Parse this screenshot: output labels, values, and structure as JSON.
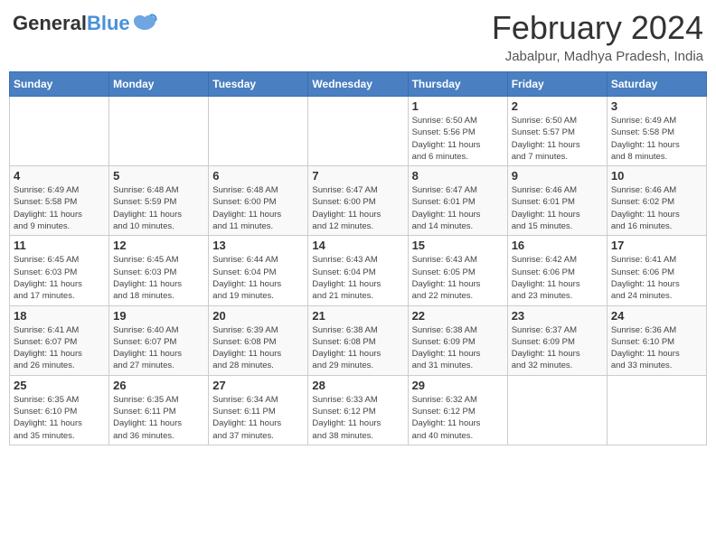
{
  "header": {
    "logo_general": "General",
    "logo_blue": "Blue",
    "month_year": "February 2024",
    "location": "Jabalpur, Madhya Pradesh, India"
  },
  "days_of_week": [
    "Sunday",
    "Monday",
    "Tuesday",
    "Wednesday",
    "Thursday",
    "Friday",
    "Saturday"
  ],
  "weeks": [
    [
      {
        "day": "",
        "info": ""
      },
      {
        "day": "",
        "info": ""
      },
      {
        "day": "",
        "info": ""
      },
      {
        "day": "",
        "info": ""
      },
      {
        "day": "1",
        "info": "Sunrise: 6:50 AM\nSunset: 5:56 PM\nDaylight: 11 hours\nand 6 minutes."
      },
      {
        "day": "2",
        "info": "Sunrise: 6:50 AM\nSunset: 5:57 PM\nDaylight: 11 hours\nand 7 minutes."
      },
      {
        "day": "3",
        "info": "Sunrise: 6:49 AM\nSunset: 5:58 PM\nDaylight: 11 hours\nand 8 minutes."
      }
    ],
    [
      {
        "day": "4",
        "info": "Sunrise: 6:49 AM\nSunset: 5:58 PM\nDaylight: 11 hours\nand 9 minutes."
      },
      {
        "day": "5",
        "info": "Sunrise: 6:48 AM\nSunset: 5:59 PM\nDaylight: 11 hours\nand 10 minutes."
      },
      {
        "day": "6",
        "info": "Sunrise: 6:48 AM\nSunset: 6:00 PM\nDaylight: 11 hours\nand 11 minutes."
      },
      {
        "day": "7",
        "info": "Sunrise: 6:47 AM\nSunset: 6:00 PM\nDaylight: 11 hours\nand 12 minutes."
      },
      {
        "day": "8",
        "info": "Sunrise: 6:47 AM\nSunset: 6:01 PM\nDaylight: 11 hours\nand 14 minutes."
      },
      {
        "day": "9",
        "info": "Sunrise: 6:46 AM\nSunset: 6:01 PM\nDaylight: 11 hours\nand 15 minutes."
      },
      {
        "day": "10",
        "info": "Sunrise: 6:46 AM\nSunset: 6:02 PM\nDaylight: 11 hours\nand 16 minutes."
      }
    ],
    [
      {
        "day": "11",
        "info": "Sunrise: 6:45 AM\nSunset: 6:03 PM\nDaylight: 11 hours\nand 17 minutes."
      },
      {
        "day": "12",
        "info": "Sunrise: 6:45 AM\nSunset: 6:03 PM\nDaylight: 11 hours\nand 18 minutes."
      },
      {
        "day": "13",
        "info": "Sunrise: 6:44 AM\nSunset: 6:04 PM\nDaylight: 11 hours\nand 19 minutes."
      },
      {
        "day": "14",
        "info": "Sunrise: 6:43 AM\nSunset: 6:04 PM\nDaylight: 11 hours\nand 21 minutes."
      },
      {
        "day": "15",
        "info": "Sunrise: 6:43 AM\nSunset: 6:05 PM\nDaylight: 11 hours\nand 22 minutes."
      },
      {
        "day": "16",
        "info": "Sunrise: 6:42 AM\nSunset: 6:06 PM\nDaylight: 11 hours\nand 23 minutes."
      },
      {
        "day": "17",
        "info": "Sunrise: 6:41 AM\nSunset: 6:06 PM\nDaylight: 11 hours\nand 24 minutes."
      }
    ],
    [
      {
        "day": "18",
        "info": "Sunrise: 6:41 AM\nSunset: 6:07 PM\nDaylight: 11 hours\nand 26 minutes."
      },
      {
        "day": "19",
        "info": "Sunrise: 6:40 AM\nSunset: 6:07 PM\nDaylight: 11 hours\nand 27 minutes."
      },
      {
        "day": "20",
        "info": "Sunrise: 6:39 AM\nSunset: 6:08 PM\nDaylight: 11 hours\nand 28 minutes."
      },
      {
        "day": "21",
        "info": "Sunrise: 6:38 AM\nSunset: 6:08 PM\nDaylight: 11 hours\nand 29 minutes."
      },
      {
        "day": "22",
        "info": "Sunrise: 6:38 AM\nSunset: 6:09 PM\nDaylight: 11 hours\nand 31 minutes."
      },
      {
        "day": "23",
        "info": "Sunrise: 6:37 AM\nSunset: 6:09 PM\nDaylight: 11 hours\nand 32 minutes."
      },
      {
        "day": "24",
        "info": "Sunrise: 6:36 AM\nSunset: 6:10 PM\nDaylight: 11 hours\nand 33 minutes."
      }
    ],
    [
      {
        "day": "25",
        "info": "Sunrise: 6:35 AM\nSunset: 6:10 PM\nDaylight: 11 hours\nand 35 minutes."
      },
      {
        "day": "26",
        "info": "Sunrise: 6:35 AM\nSunset: 6:11 PM\nDaylight: 11 hours\nand 36 minutes."
      },
      {
        "day": "27",
        "info": "Sunrise: 6:34 AM\nSunset: 6:11 PM\nDaylight: 11 hours\nand 37 minutes."
      },
      {
        "day": "28",
        "info": "Sunrise: 6:33 AM\nSunset: 6:12 PM\nDaylight: 11 hours\nand 38 minutes."
      },
      {
        "day": "29",
        "info": "Sunrise: 6:32 AM\nSunset: 6:12 PM\nDaylight: 11 hours\nand 40 minutes."
      },
      {
        "day": "",
        "info": ""
      },
      {
        "day": "",
        "info": ""
      }
    ]
  ]
}
